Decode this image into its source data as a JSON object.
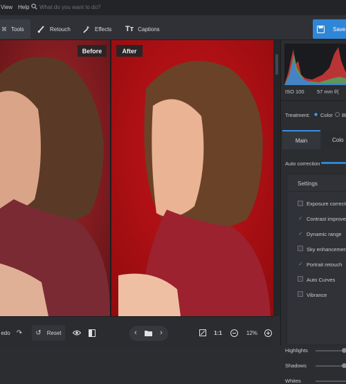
{
  "menu": {
    "view": "View",
    "help": "Help",
    "search_placeholder": "What do you want to do?"
  },
  "toolbar": {
    "tools": "Tools",
    "retouch": "Retouch",
    "effects": "Effects",
    "captions": "Captions",
    "save": "Save"
  },
  "canvas": {
    "before": "Before",
    "after": "After"
  },
  "panel": {
    "iso": "ISO 100",
    "focal": "57 mm f/(",
    "treatment_label": "Treatment:",
    "treatment_color": "Color",
    "treatment_bw": "Bl",
    "tab_main": "Main",
    "tab_color": "Colo",
    "auto_correction": "Auto correction",
    "settings": "Settings",
    "options": [
      {
        "label": "Exposure correction",
        "checked": false
      },
      {
        "label": "Contrast improvement",
        "checked": true
      },
      {
        "label": "Dynamic range",
        "checked": true
      },
      {
        "label": "Sky enhancement",
        "checked": false
      },
      {
        "label": "Portrait retouch",
        "checked": true
      },
      {
        "label": "Auto Curves",
        "checked": false
      },
      {
        "label": "Vibrance",
        "checked": false
      }
    ],
    "highlights": "Highlights",
    "shadows": "Shadows",
    "whites": "Whites"
  },
  "bottombar": {
    "undo": "edo",
    "reset": "Reset",
    "ratio": "1:1",
    "zoom": "12%"
  },
  "colors": {
    "accent": "#2f86d6",
    "backdrop": "#b30f12"
  }
}
